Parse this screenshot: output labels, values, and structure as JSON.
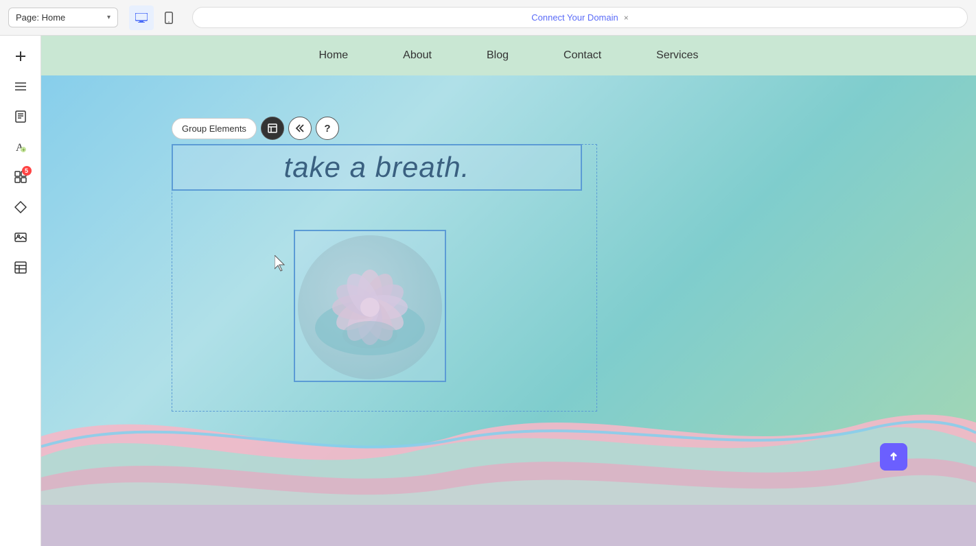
{
  "browser": {
    "page_label": "Page: Home",
    "address_text": "Connect Your Domain",
    "close_label": "×",
    "desktop_icon": "🖥",
    "mobile_icon": "📱"
  },
  "sidebar": {
    "items": [
      {
        "name": "add",
        "icon": "＋",
        "badge": false
      },
      {
        "name": "layers",
        "icon": "≡",
        "badge": false
      },
      {
        "name": "pages",
        "icon": "☰",
        "badge": false
      },
      {
        "name": "text",
        "icon": "A",
        "badge": false
      },
      {
        "name": "apps",
        "icon": "⊞",
        "badge": true,
        "badge_count": "5"
      },
      {
        "name": "components",
        "icon": "⊞",
        "badge": false
      },
      {
        "name": "media",
        "icon": "🖼",
        "badge": false
      },
      {
        "name": "table",
        "icon": "⊞",
        "badge": false
      }
    ]
  },
  "website": {
    "nav": {
      "links": [
        "Home",
        "About",
        "Blog",
        "Contact",
        "Services"
      ]
    },
    "hero": {
      "text": "take a breath.",
      "lotus_emoji": "🌸"
    }
  },
  "toolbar": {
    "group_elements_label": "Group Elements",
    "icon1": "⊞",
    "icon2": "«",
    "icon3": "?"
  },
  "scroll_top_icon": "↑",
  "colors": {
    "accent_blue": "#5b9bd5",
    "sidebar_bg": "#ffffff",
    "nav_bg": "#c8e6d2",
    "hero_gradient_start": "#87ceeb",
    "hero_gradient_end": "#a8d8b0",
    "wave_pink": "#f4b8c8",
    "wave_mint": "#a8dfd4",
    "wave_blue": "#87ceeb",
    "scroll_btn": "#6b5fff"
  }
}
